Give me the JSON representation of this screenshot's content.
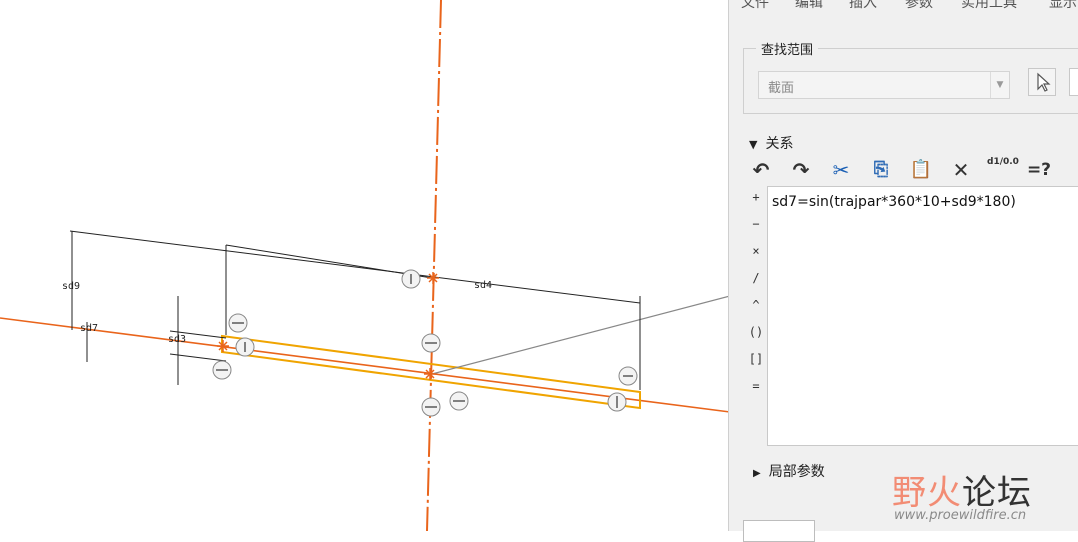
{
  "menu": [
    "文件",
    "编辑",
    "插入",
    "参数",
    "实用工具",
    "显示"
  ],
  "search": {
    "title": "查找范围",
    "value": "截面"
  },
  "relations": {
    "title": "关系",
    "text": "sd7=sin(trajpar*360*10+sd9*180)",
    "operators": [
      "+",
      "−",
      "×",
      "/",
      "^",
      "()",
      "[]",
      "="
    ]
  },
  "toolbar": {
    "undo": "↶",
    "redo": "↷",
    "cut": "✂",
    "copy": "⎘",
    "paste": "📋",
    "delete": "✕",
    "switch_units": "d1/0.0",
    "verify": "=?"
  },
  "local_params": {
    "title": "局部参数"
  },
  "sketch": {
    "dims": [
      "sd9",
      "sd7",
      "sd3",
      "sd4"
    ]
  },
  "watermark": {
    "big1": "野火",
    "big2": "论坛",
    "url": "www.proewildfire.cn"
  },
  "colors": {
    "orange": "#e9641b",
    "yellow": "#f0a400",
    "panel": "#f0f0f0"
  }
}
